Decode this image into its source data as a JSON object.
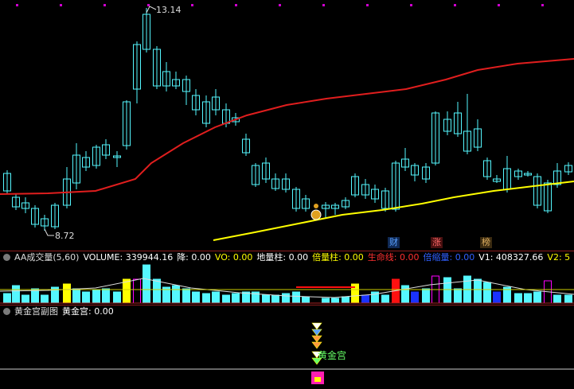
{
  "price_panel": {
    "high_label": "13.14",
    "low_label": "8.72",
    "badges": [
      {
        "text": "财",
        "color": "#5aa0ff",
        "bg": "#102a55"
      },
      {
        "text": "涨",
        "color": "#ff6a6a",
        "bg": "#4a1010"
      },
      {
        "text": "榜",
        "color": "#e0b060",
        "bg": "#3a2a10"
      }
    ]
  },
  "volume_panel": {
    "title": "AA成交量(5,60)",
    "metrics": [
      {
        "text": "VOLUME: 339944.16",
        "color": "#ffffff"
      },
      {
        "text": "降: 0.00",
        "color": "#ffffff"
      },
      {
        "text": "VO: 0.00",
        "color": "#ffff00"
      },
      {
        "text": "地量柱: 0.00",
        "color": "#ffffff"
      },
      {
        "text": "倍量柱: 0.00",
        "color": "#ffff00"
      },
      {
        "text": "生命线: 0.00",
        "color": "#ff3030"
      },
      {
        "text": "倍缩量: 0.00",
        "color": "#3060ff"
      },
      {
        "text": "V1: 408327.66",
        "color": "#ffffff"
      },
      {
        "text": "V2: 5",
        "color": "#ffff00"
      }
    ]
  },
  "gold_panel": {
    "title": "黄金宫副图",
    "metrics": [
      {
        "text": "黄金宫: 0.00",
        "color": "#ffffff"
      }
    ],
    "marker_label": "黄金宫"
  },
  "colors": {
    "up": "#ff00ff",
    "down": "#55f7ff",
    "ma_long": "#e01e1e",
    "ma_short": "#ffff00"
  }
}
